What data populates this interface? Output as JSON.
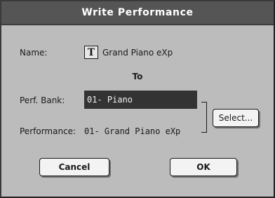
{
  "dialog": {
    "title": "Write Performance"
  },
  "name_row": {
    "label": "Name:",
    "edit_icon_glyph": "T",
    "value": "Grand Piano eXp"
  },
  "to_heading": "To",
  "bank_row": {
    "label": "Perf. Bank:",
    "value": "01- Piano"
  },
  "performance_row": {
    "label": "Performance:",
    "value": "01- Grand Piano eXp"
  },
  "buttons": {
    "select_label": "Select...",
    "cancel_label": "Cancel",
    "ok_label": "OK"
  },
  "colors": {
    "titlebar": "#555555",
    "dialog_bg": "#bcbcbc",
    "field_bg": "#333333",
    "button_bg": "#f3f3f3"
  },
  "icons": {
    "edit_name": "text-edit-icon"
  }
}
